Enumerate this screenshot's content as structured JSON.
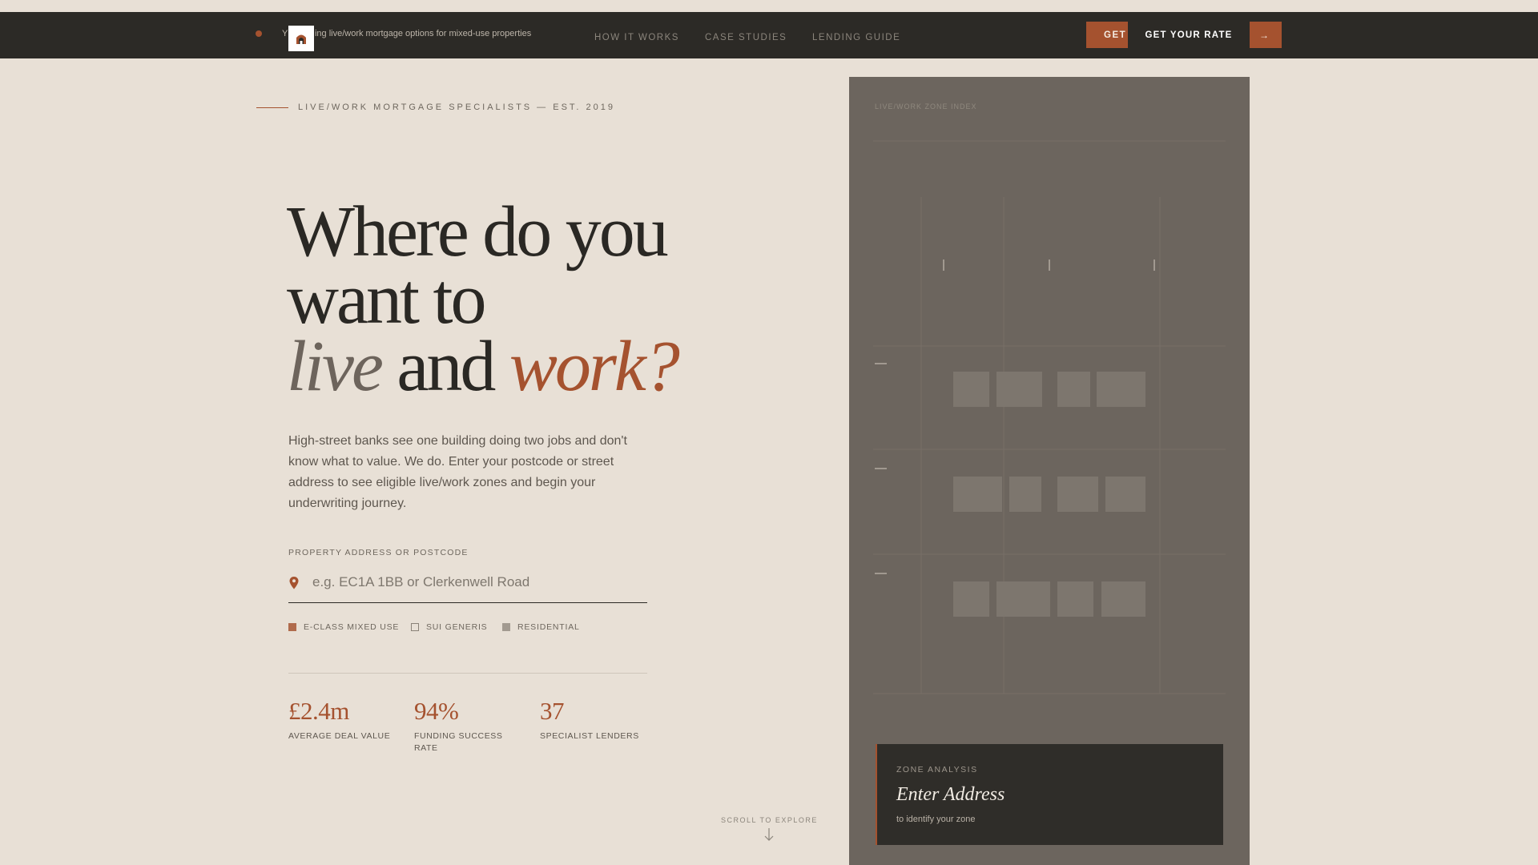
{
  "nav": {
    "banner_text": "Y… ie…ing live/work mortgage options for mixed-use properties",
    "links": [
      "HOW IT WORKS",
      "CASE STUDIES",
      "LENDING GUIDE"
    ],
    "cta_back_label": "GET",
    "cta_label": "GET YOUR RATE",
    "cta_arrow": "→"
  },
  "hero": {
    "eyebrow": "LIVE/WORK MORTGAGE SPECIALISTS — EST. 2019",
    "headline_line1": "Where do you",
    "headline_line2": "want to",
    "headline_live": "live",
    "headline_and": " and ",
    "headline_work": "work?",
    "lead": "High-street banks see one building doing two jobs and don't know what to value. We do. Enter your postcode or street address to see eligible live/work zones and begin your underwriting journey."
  },
  "search": {
    "label": "PROPERTY ADDRESS OR POSTCODE",
    "placeholder": "e.g. EC1A 1BB or Clerkenwell Road",
    "value": ""
  },
  "legend": [
    {
      "label": "E-CLASS MIXED USE",
      "color": "#b06b4c",
      "style": "filled"
    },
    {
      "label": "SUI GENERIS",
      "color": "#8a8278",
      "style": "outline"
    },
    {
      "label": "RESIDENTIAL",
      "color": "#a29a90",
      "style": "filled"
    }
  ],
  "stats": [
    {
      "value": "£2.4m",
      "label": "AVERAGE DEAL VALUE"
    },
    {
      "value": "94%",
      "label": "FUNDING SUCCESS RATE"
    },
    {
      "value": "37",
      "label": "SPECIALIST LENDERS"
    }
  ],
  "scroll": {
    "label": "SCROLL TO EXPLORE"
  },
  "panel": {
    "title": "LIVE/WORK ZONE INDEX",
    "card": {
      "eyebrow": "ZONE ANALYSIS",
      "title": "Enter Address",
      "subtitle": "to identify your zone"
    }
  },
  "colors": {
    "accent": "#a5522f",
    "dark": "#2c2a26",
    "background": "#e8e0d6",
    "panel": "#6c655e"
  }
}
